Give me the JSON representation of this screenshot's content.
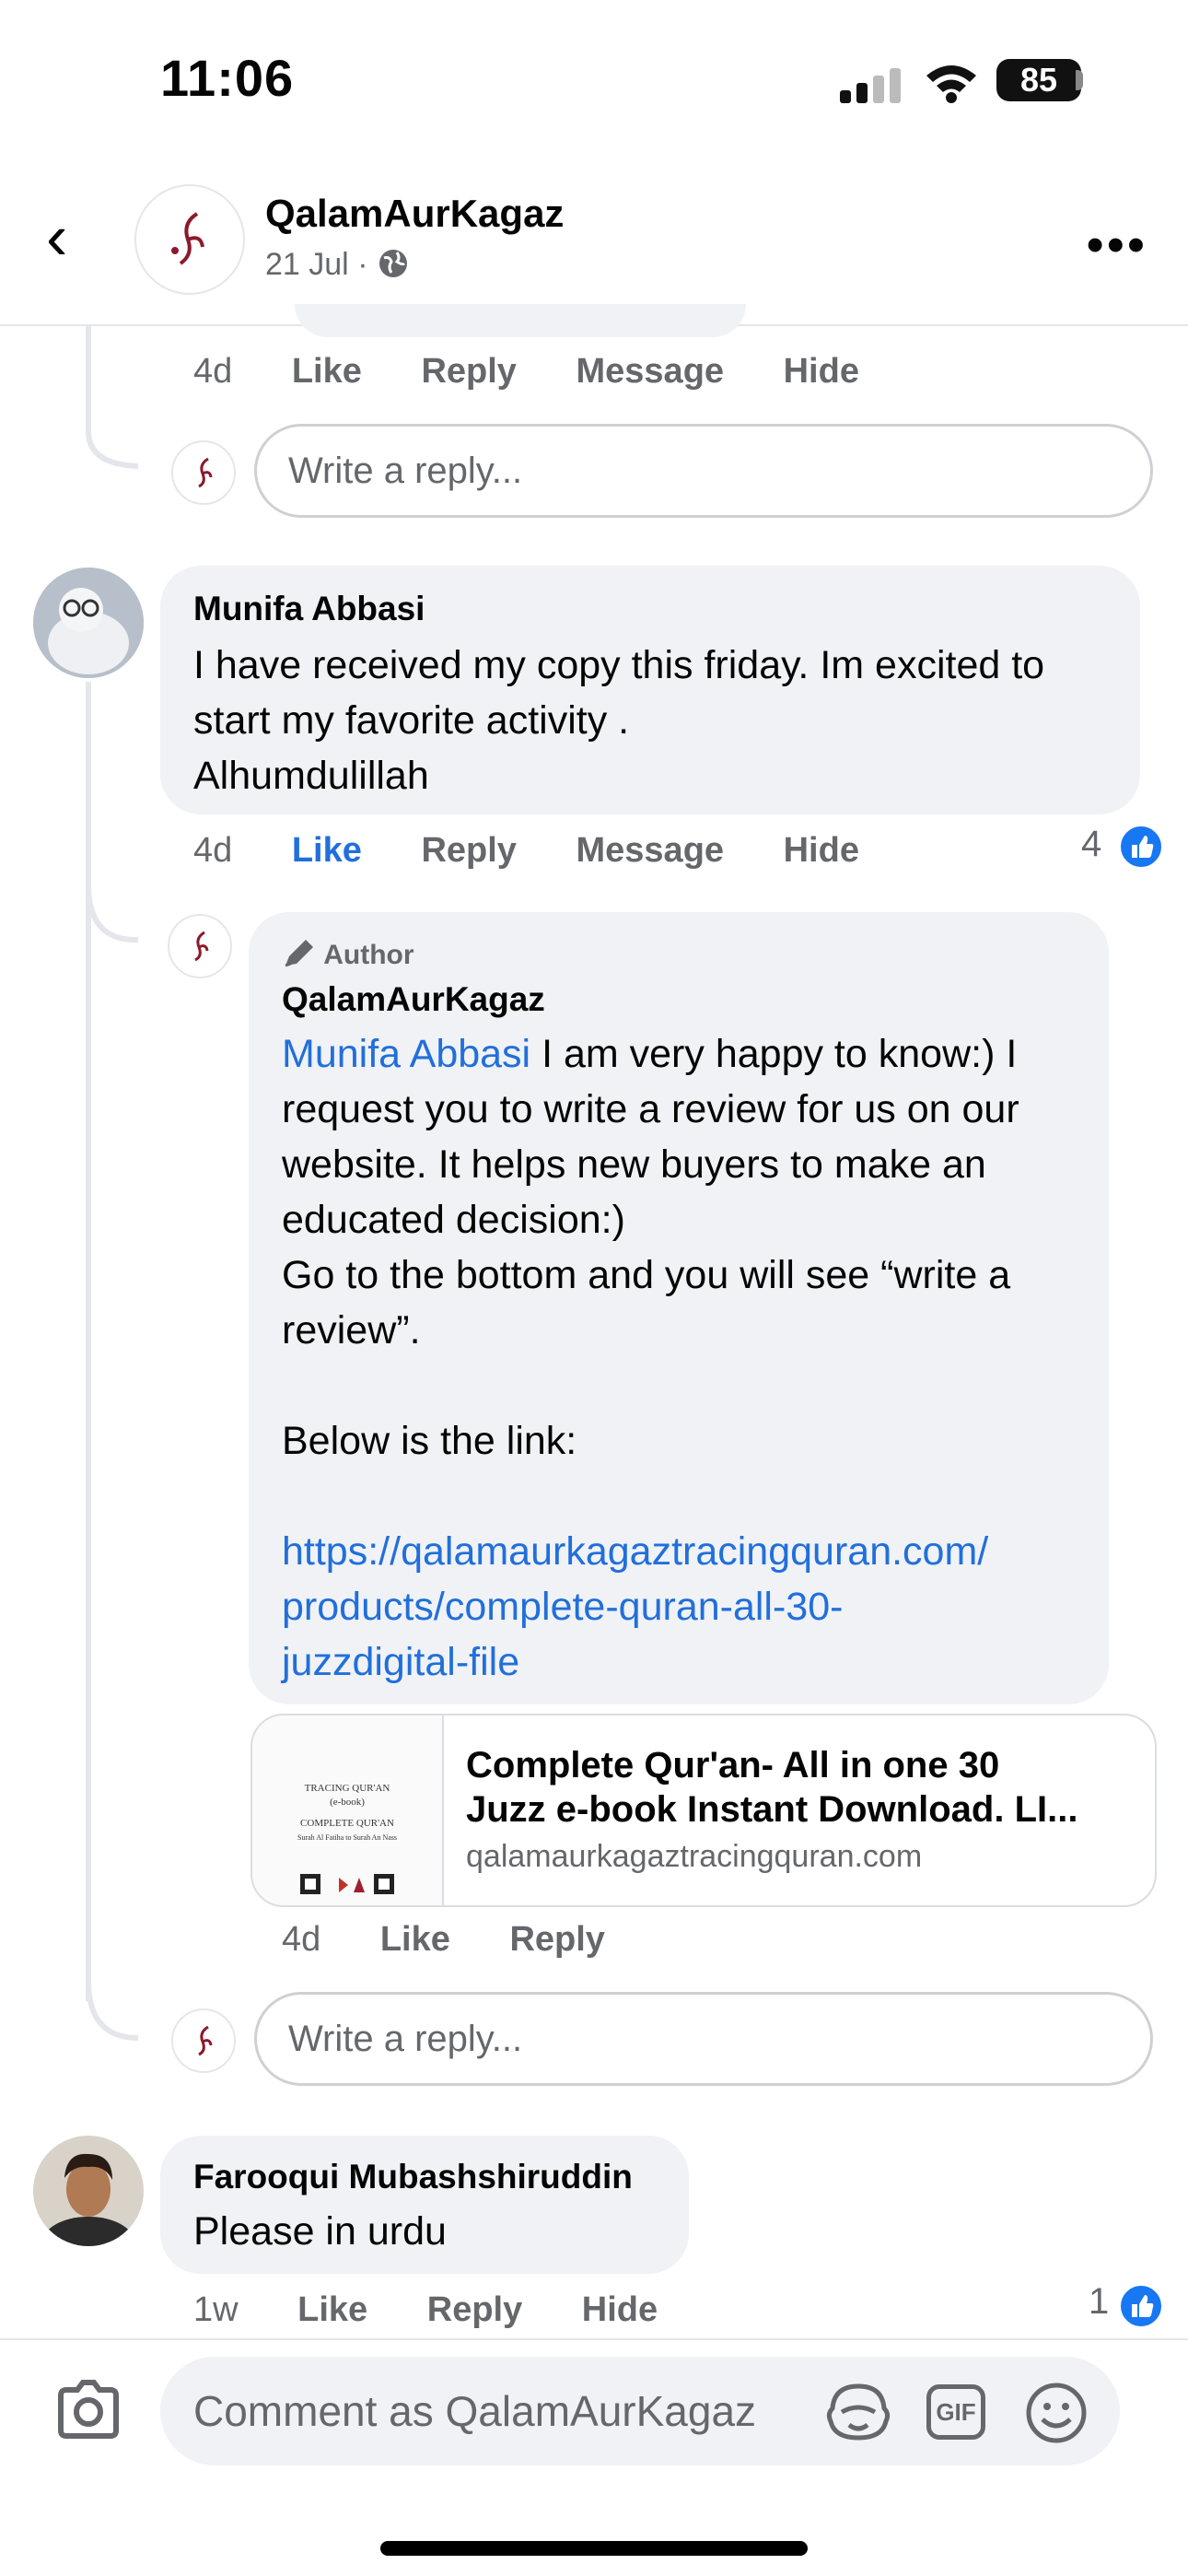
{
  "status_bar": {
    "time": "11:06",
    "battery": "85"
  },
  "header": {
    "page_name": "QalamAurKagaz",
    "post_date": "21 Jul",
    "separator": "·"
  },
  "actions": {
    "like": "Like",
    "reply": "Reply",
    "message": "Message",
    "hide": "Hide"
  },
  "top_thread": {
    "timestamp": "4d",
    "reply_placeholder": "Write a reply..."
  },
  "comments": [
    {
      "author": "Munifa Abbasi",
      "lines": [
        "I have received my copy this friday. Im excited to",
        "start my favorite activity .",
        "Alhumdulillah"
      ],
      "timestamp": "4d",
      "like_count": "4",
      "reply": {
        "badge": "Author",
        "author": "QalamAurKagaz",
        "mention": "Munifa Abbasi",
        "line1_rest": " I am very happy to know:) I",
        "lines": [
          "request you to write a review for us on our",
          "website. It helps new buyers to make an",
          "educated decision:)",
          "Go to the bottom and you will see “write a",
          "review”."
        ],
        "below": "Below is the link:",
        "url_lines": [
          "https://qalamaurkagaztracingquran.com/",
          "products/complete-quran-all-30-",
          "juzzdigital-file"
        ],
        "preview": {
          "title_lines": [
            "Complete Qur'an- All in one 30",
            "Juzz e-book Instant Download. LI..."
          ],
          "domain": "qalamaurkagaztracingquran.com",
          "thumb_lines": [
            "TRACING QUR'AN",
            "(e-book)",
            "COMPLETE QUR'AN",
            "Surah Al Fatiha to Surah An Nass"
          ]
        },
        "timestamp": "4d"
      },
      "reply_placeholder": "Write a reply..."
    },
    {
      "author": "Farooqui Mubashshiruddin",
      "text": "Please in urdu",
      "timestamp": "1w",
      "like_count": "1"
    }
  ],
  "composer": {
    "placeholder": "Comment as QalamAurKagaz",
    "gif_label": "GIF"
  },
  "colors": {
    "link": "#216fdb",
    "like_blue": "#1877f2",
    "bubble": "#f0f2f5"
  }
}
